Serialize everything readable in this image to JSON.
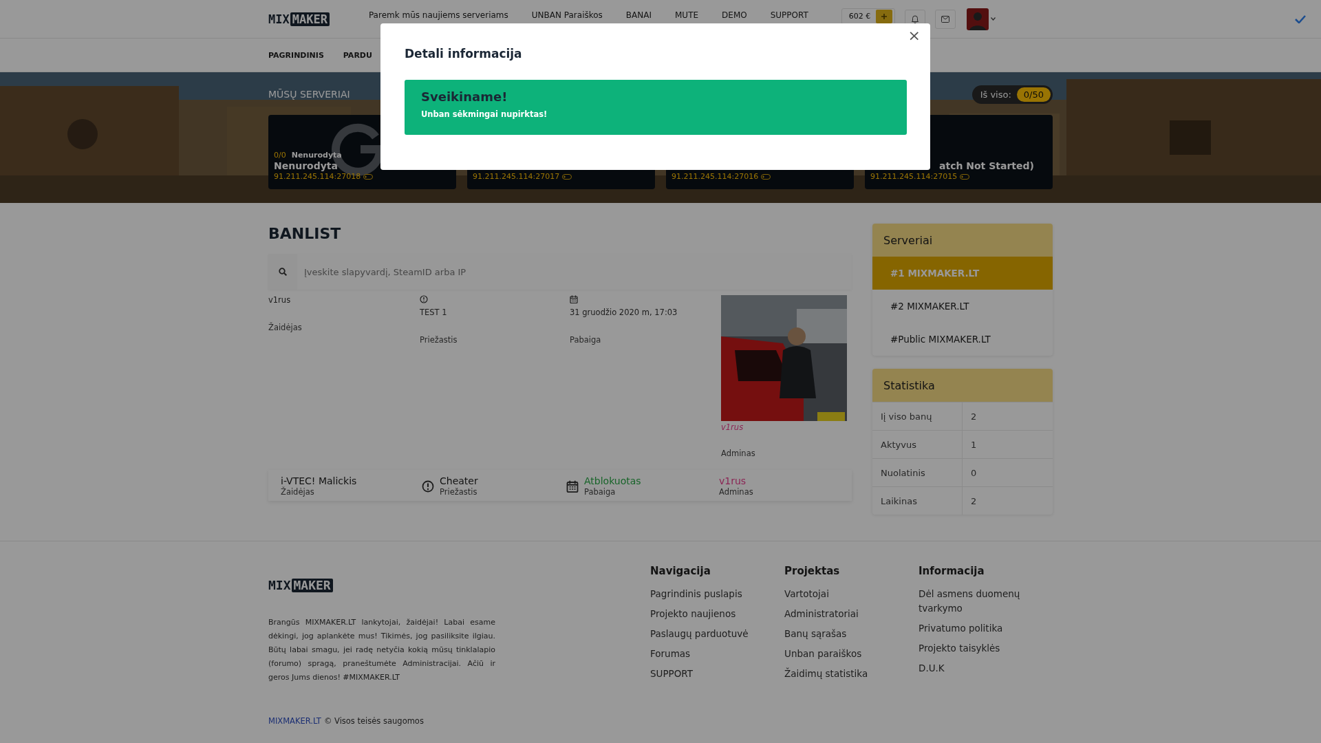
{
  "header": {
    "logo": {
      "left": "MIX",
      "right": "MAKER"
    },
    "nav": [
      {
        "label": "Paremk mūs naujiems serveriams"
      },
      {
        "label": "UNBAN Paraiškos"
      },
      {
        "label": "BANAI"
      },
      {
        "label": "MUTE"
      },
      {
        "label": "DEMO"
      },
      {
        "label": "SUPPORT"
      }
    ],
    "balance": "602 €"
  },
  "subnav": [
    {
      "label": "PAGRINDINIS"
    },
    {
      "label": "PARDU"
    }
  ],
  "servers": {
    "title": "MŪSŲ SERVERIAI",
    "total_label": "Iš viso:",
    "total": "0/50",
    "cards": [
      {
        "players": "0/0",
        "map": "Nenurodyta",
        "name": "Nenurodyta",
        "address": "91.211.245.114:27018"
      },
      {
        "address": "91.211.245.114:27017"
      },
      {
        "address": "91.211.245.114:27016"
      },
      {
        "name": "atch Not Started)",
        "clipped": true,
        "address": "91.211.245.114:27015"
      }
    ]
  },
  "banlist": {
    "title": "BANLIST",
    "search": {
      "placeholder": "Įveskite slapyvardį, SteamID arba IP"
    },
    "detail": {
      "player": "v1rus",
      "player_label": "Žaidėjas",
      "reason": "TEST 1",
      "reason_label": "Priežastis",
      "end": "31 gruodžio 2020 m, 17:03",
      "end_label": "Pabaiga",
      "admin": "v1rus",
      "admin_label": "Adminas"
    },
    "rows": [
      {
        "player": "i-VTEC! Malickis",
        "player_label": "Žaidėjas",
        "reason": "Cheater",
        "reason_label": "Priežastis",
        "end": "Atblokuotas",
        "active": false,
        "end_label": "Pabaiga",
        "admin": "v1rus",
        "admin_label": "Adminas"
      }
    ]
  },
  "sidebar": {
    "servers": {
      "title": "Serveriai",
      "items": [
        {
          "label": "#1 MIXMAKER.LT",
          "selected": true
        },
        {
          "label": "#2 MIXMAKER.LT",
          "selected": false
        },
        {
          "label": "#Public MIXMAKER.LT",
          "selected": false
        }
      ]
    },
    "stats": {
      "title": "Statistika",
      "rows": [
        {
          "label": "Iį viso banų",
          "value": "2"
        },
        {
          "label": "Aktyvus",
          "value": "1"
        },
        {
          "label": "Nuolatinis",
          "value": "0"
        },
        {
          "label": "Laikinas",
          "value": "2"
        }
      ]
    }
  },
  "footer": {
    "logo": {
      "left": "MIX",
      "right": "MAKER"
    },
    "about": "Brangūs MIXMAKER.LT lankytojai, žaidėjai! Labai esame dėkingi, jog aplankėte mus! Tikimės, jog pasiliksite ilgiau. Būtų labai smagu, jei radę netyčia kokią mūsų tinklalapio (forumo) spragą, praneštumėte Administracijai. Ačiū ir geros Jums dienos! #MIXMAKER.LT",
    "columns": [
      {
        "title": "Navigacija",
        "links": [
          "Pagrindinis puslapis",
          "Projekto naujienos",
          "Paslaugų parduotuvė",
          "Forumas",
          "SUPPORT"
        ]
      },
      {
        "title": "Projektas",
        "links": [
          "Vartotojai",
          "Administratoriai",
          "Banų sąrašas",
          "Unban paraiškos",
          "Žaidimų statistika"
        ]
      },
      {
        "title": "Informacija",
        "links": [
          "Dėl asmens duomenų tvarkymo",
          "Privatumo politika",
          "Projekto taisyklės",
          "D.U.K"
        ]
      }
    ],
    "copyright_link": "MIXMAKER.LT",
    "copyright": "© Visos teisės saugomos"
  },
  "modal": {
    "title": "Detali informacija",
    "close": "×",
    "alert": {
      "title": "Sveikiname!",
      "message": "Unban sėkmingai nupirktas!"
    }
  }
}
